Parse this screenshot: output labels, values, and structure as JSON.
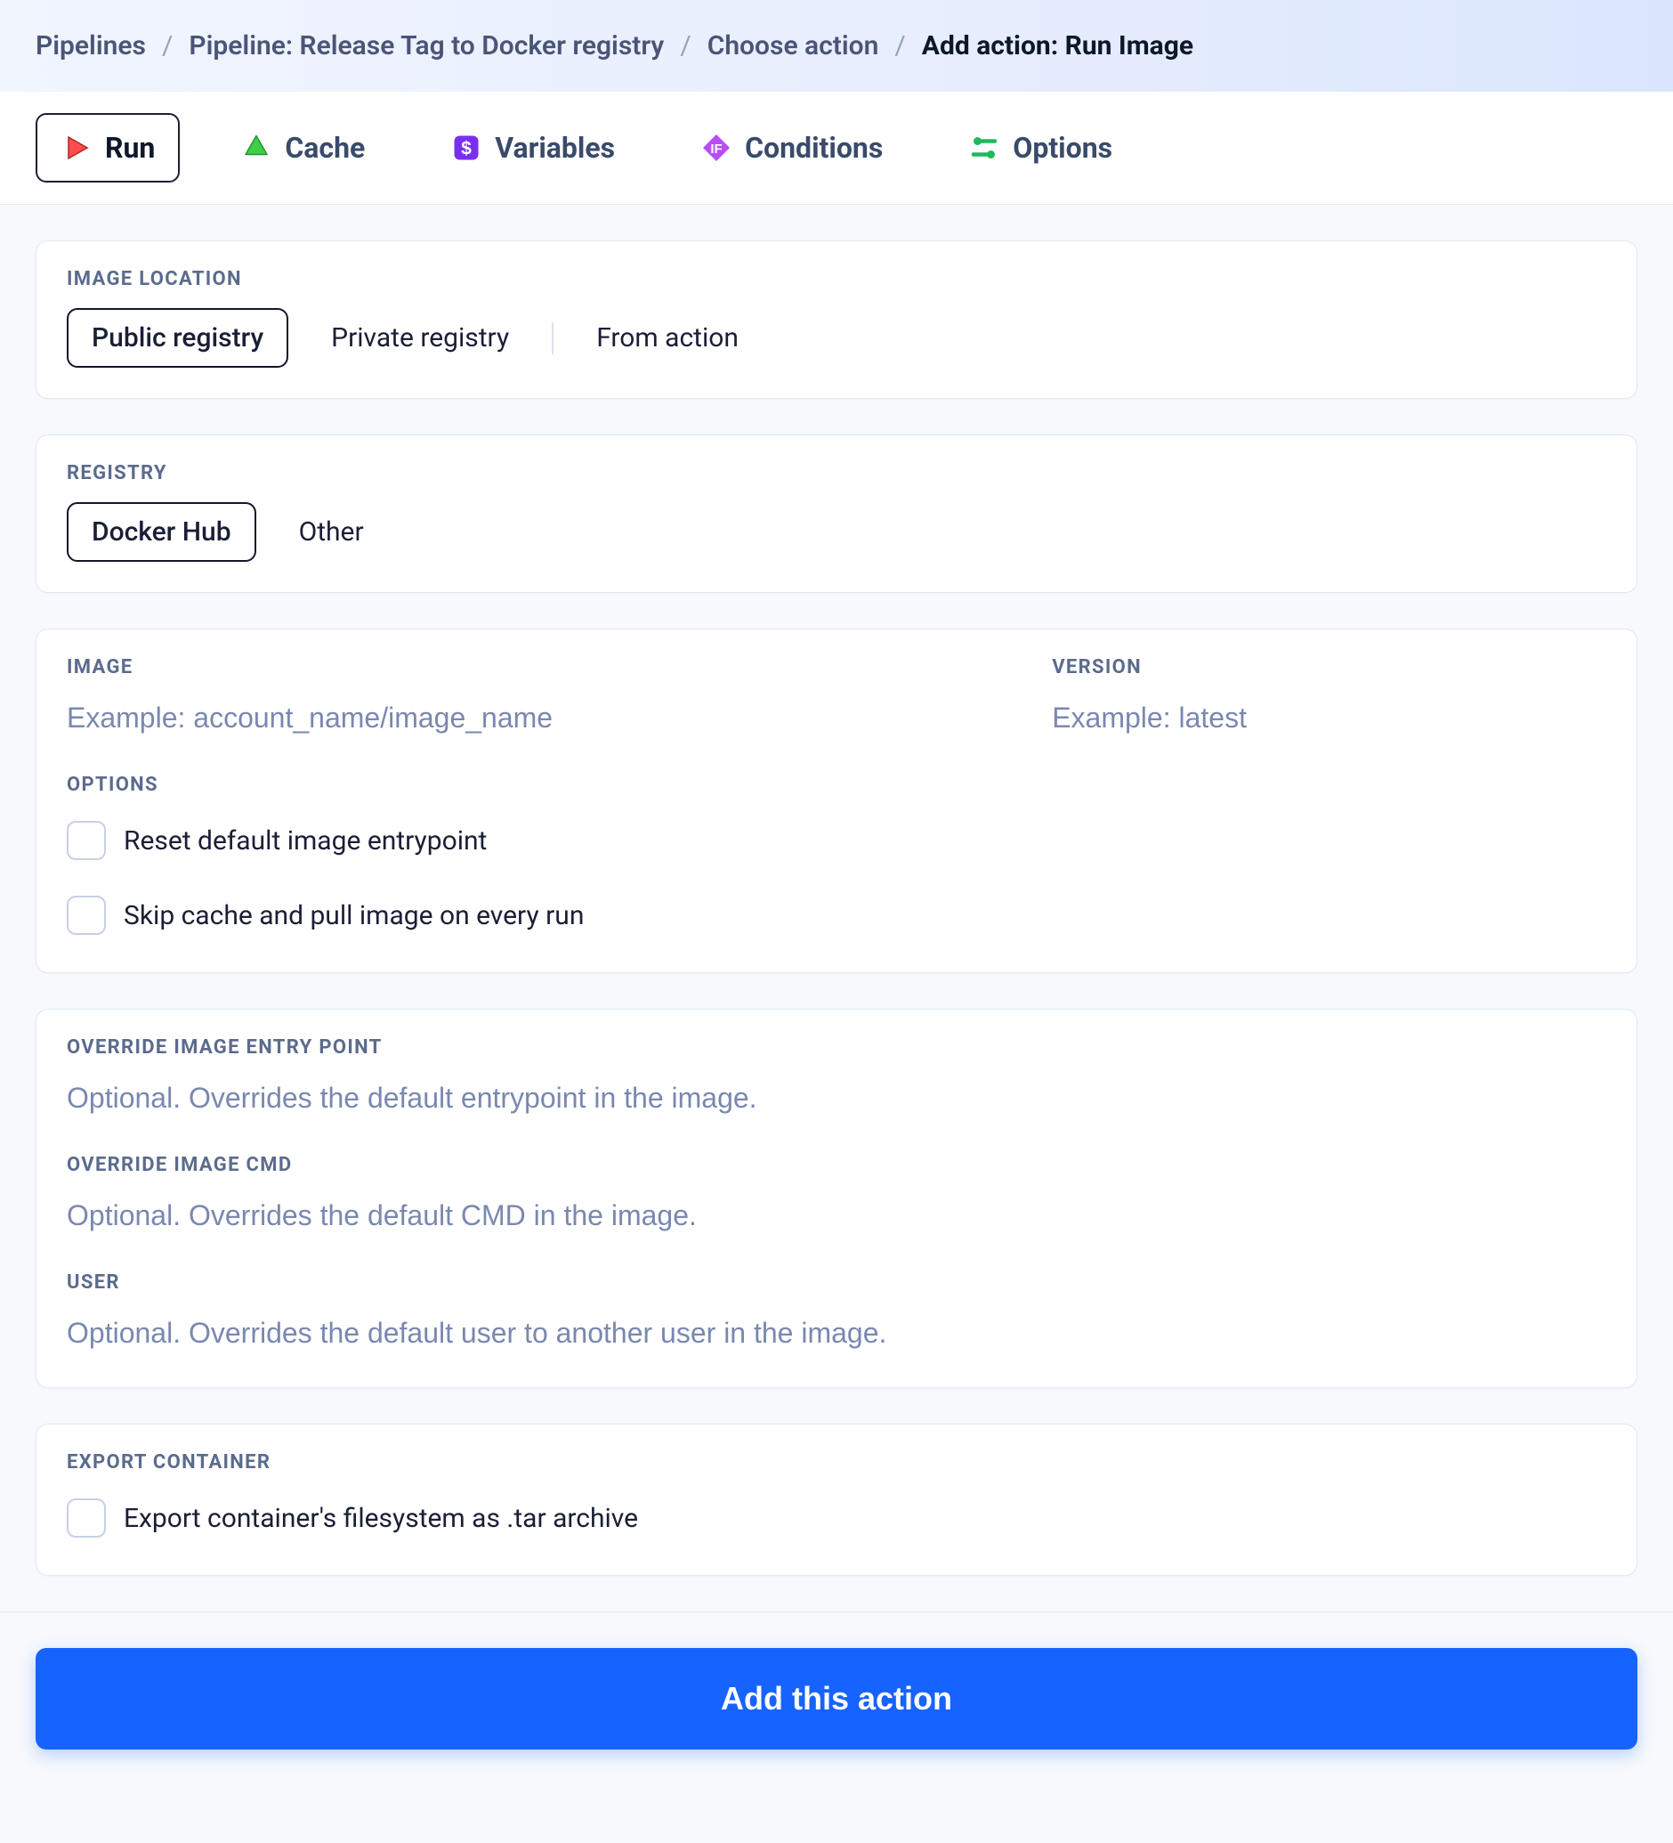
{
  "breadcrumbs": {
    "items": [
      {
        "label": "Pipelines"
      },
      {
        "label": "Pipeline: Release Tag to Docker registry"
      },
      {
        "label": "Choose action"
      },
      {
        "label": "Add action: Run Image"
      }
    ]
  },
  "tabs": {
    "run": "Run",
    "cache": "Cache",
    "variables": "Variables",
    "conditions": "Conditions",
    "options": "Options"
  },
  "image_location": {
    "label": "Image Location",
    "public": "Public registry",
    "private": "Private registry",
    "from_action": "From action"
  },
  "registry": {
    "label": "Registry",
    "docker_hub": "Docker Hub",
    "other": "Other"
  },
  "image": {
    "label": "Image",
    "placeholder": "Example: account_name/image_name"
  },
  "version": {
    "label": "Version",
    "placeholder": "Example: latest"
  },
  "options": {
    "label": "Options",
    "reset_entrypoint": "Reset default image entrypoint",
    "skip_cache": "Skip cache and pull image on every run"
  },
  "override_entrypoint": {
    "label": "Override Image Entry Point",
    "placeholder": "Optional. Overrides the default entrypoint in the image."
  },
  "override_cmd": {
    "label": "Override Image CMD",
    "placeholder": "Optional. Overrides the default CMD in the image."
  },
  "user": {
    "label": "User",
    "placeholder": "Optional. Overrides the default user to another user in the image."
  },
  "export": {
    "label": "Export Container",
    "checkbox": "Export container's filesystem as .tar archive"
  },
  "submit": {
    "label": "Add this action"
  }
}
